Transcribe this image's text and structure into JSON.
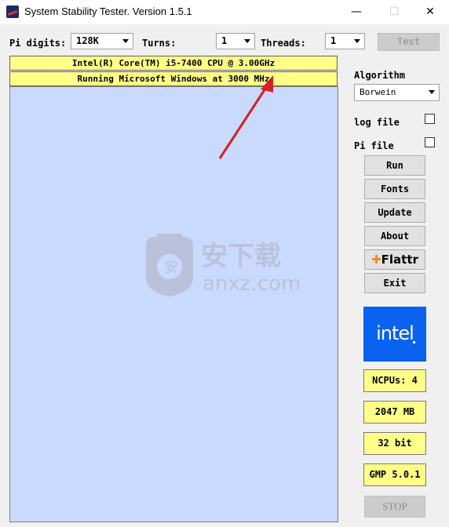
{
  "window": {
    "title": "System Stability Tester. Version 1.5.1",
    "minimize": "—",
    "maximize": "☐",
    "close": "✕"
  },
  "toolbar": {
    "pi_digits_label": "Pi digits:",
    "pi_digits_value": "128K",
    "turns_label": "Turns:",
    "turns_value": "1",
    "threads_label": "Threads:",
    "threads_value": "1",
    "test_button": "Test"
  },
  "info_bars": {
    "cpu": "Intel(R) Core(TM) i5-7400 CPU @ 3.00GHz",
    "os": "Running Microsoft Windows at 3000 MHz"
  },
  "sidebar": {
    "algorithm_label": "Algorithm",
    "algorithm_value": "Borwein",
    "log_file_label": "log file",
    "pi_file_label": "Pi file",
    "buttons": {
      "run": "Run",
      "fonts": "Fonts",
      "update": "Update",
      "about": "About",
      "flattr": "Flattr",
      "exit": "Exit"
    },
    "intel_logo": "intel",
    "ncpus": "NCPUs: 4",
    "memory": "2047 MB",
    "bits": "32 bit",
    "gmp": "GMP 5.0.1",
    "stop_button": "STOP"
  },
  "watermark": {
    "cn": "安下载",
    "domain": "anxz.com"
  },
  "colors": {
    "info_yellow": "#ffff88",
    "panel_blue": "#cad9fe",
    "intel_blue": "#0a62f0",
    "arrow_red": "#d42020"
  }
}
